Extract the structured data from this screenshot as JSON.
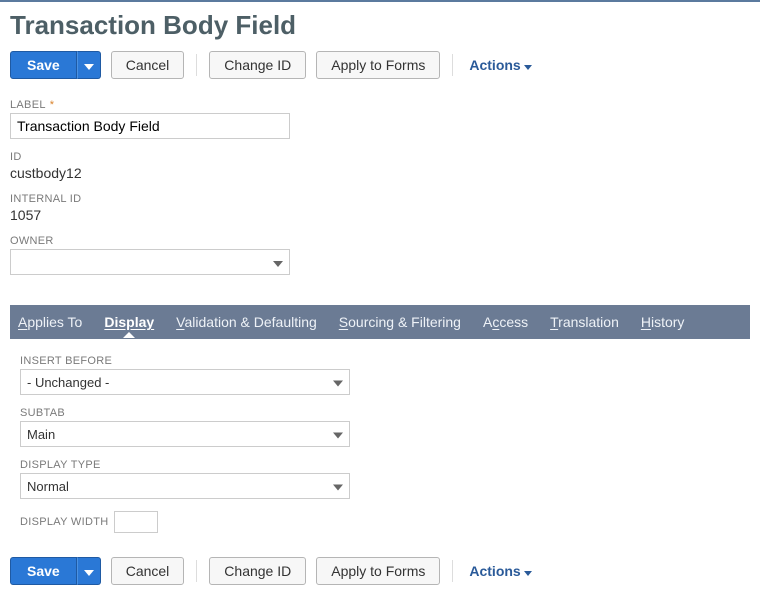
{
  "page": {
    "title": "Transaction Body Field"
  },
  "toolbar": {
    "save": "Save",
    "cancel": "Cancel",
    "change_id": "Change ID",
    "apply_to_forms": "Apply to Forms",
    "actions": "Actions"
  },
  "fields": {
    "label": {
      "label": "LABEL",
      "value": "Transaction Body Field"
    },
    "id": {
      "label": "ID",
      "value": "custbody12"
    },
    "internal_id": {
      "label": "INTERNAL ID",
      "value": "1057"
    },
    "owner": {
      "label": "OWNER",
      "value": ""
    }
  },
  "tabs": {
    "applies_to": "Applies To",
    "display": "Display",
    "validation": "Validation & Defaulting",
    "sourcing": "Sourcing & Filtering",
    "access": "Access",
    "translation": "Translation",
    "history": "History"
  },
  "display_tab": {
    "insert_before": {
      "label": "INSERT BEFORE",
      "value": "- Unchanged -"
    },
    "subtab": {
      "label": "SUBTAB",
      "value": "Main"
    },
    "display_type": {
      "label": "DISPLAY TYPE",
      "value": "Normal"
    },
    "display_width": {
      "label": "DISPLAY WIDTH",
      "value": ""
    }
  }
}
